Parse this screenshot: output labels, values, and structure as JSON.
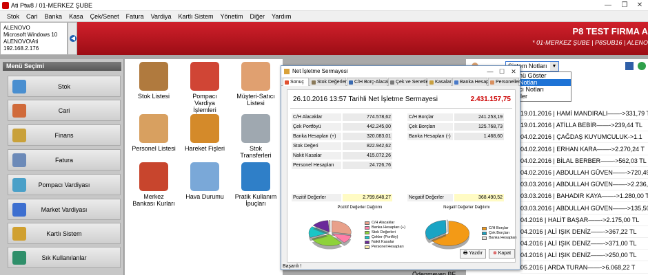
{
  "window": {
    "title": "Ati Ptw8  /  01-MERKEZ ŞUBE"
  },
  "menu": [
    "Stok",
    "Cari",
    "Banka",
    "Kasa",
    "Çek/Senet",
    "Fatura",
    "Vardiya",
    "Kartlı Sistem",
    "Yönetim",
    "Diğer",
    "Yardım"
  ],
  "info": [
    "ALENOVO",
    "Microsoft Windows 10",
    "ALENOVO\\Ati",
    "192.168.2.176"
  ],
  "banner": {
    "firm": "P8 TEST FIRMA A",
    "sub": "* 01-MERKEZ ŞUBE | P8SUB16 | ALENO"
  },
  "sidebar": {
    "header": "Menü Seçimi",
    "items": [
      {
        "label": "Stok",
        "color": "#4a8fd0"
      },
      {
        "label": "Cari",
        "color": "#d06a3a"
      },
      {
        "label": "Finans",
        "color": "#c9a13a"
      },
      {
        "label": "Fatura",
        "color": "#6c8ab8"
      },
      {
        "label": "Pompacı Vardiyası",
        "color": "#4aa0c8"
      },
      {
        "label": "Market Vardiyası",
        "color": "#3d6fd0"
      },
      {
        "label": "Kartlı Sistem",
        "color": "#d0a030"
      },
      {
        "label": "Sık Kullanılanlar",
        "color": "#2f8f6a"
      }
    ]
  },
  "tiles": [
    {
      "label": "Stok Listesi",
      "color": "#b07a3e"
    },
    {
      "label": "Pompacı Vardiya İşlemleri",
      "color": "#d04535"
    },
    {
      "label": "Müşteri-Satıcı Listesi",
      "color": "#e0a070"
    },
    {
      "label": "Personel Listesi",
      "color": "#d8a060"
    },
    {
      "label": "Hareket Fişleri",
      "color": "#d48a2a"
    },
    {
      "label": "Stok Transferleri",
      "color": "#9fa8b0"
    },
    {
      "label": "Merkez Bankası Kurları",
      "color": "#c8452d"
    },
    {
      "label": "Hava Durumu",
      "color": "#7aa8d8"
    },
    {
      "label": "Pratik Kullanım İpuçları",
      "color": "#2f7fc8"
    }
  ],
  "notes": {
    "selected": "Sistem Notları",
    "options": [
      "nü Göster",
      "Notları",
      "cı Notları",
      "ller"
    ],
    "label": "Notlar"
  },
  "log": [
    "19.01.2016 | HAMİ MANDIRALI——->331,79 T",
    "19.01.2016 | ATİLLA BEBİR——->239,44 TL",
    "04.02.2016 | ÇAĞDAŞ KUYUMCULUK->1.1",
    "04.02.2016 | ERHAN KARA——->2.270,24 T",
    "04.02.2016 | BİLAL    BERBER——->562,03 TL",
    "04.02.2016 | ABDULLAH GÜVEN——->720,49 T",
    "03.03.2016 | ABDULLAH GÜVEN——->2.236,50",
    "03.03.2016 | BAHADIR KAYA——->1.280,00 T",
    "03.03.2016 | ABDULLAH GÜVEN——->135,50 T",
    "04.2016 | HALİT BAŞAR——->2.175,00 TL",
    "04.2016 | ALİ IŞIK DENİZ——->367,22 TL",
    "04.2016 | ALİ IŞIK DENİZ——->371,00 TL",
    "04.2016 | ALİ IŞIK DENİZ——->250,00 TL",
    "05.2016 | ARDA TURAN——->6.068,22 T",
    "05.2016 | ABDULLAH GÜVEN——->225,85 T"
  ],
  "log_prefix": "Ödenmeyen BF",
  "dialog": {
    "title": "Net İşletme Sermayesi",
    "tabs": [
      "Sonuç",
      "Stok Değerleri",
      "C/H Borç-Alacak",
      "Çek ve Senetler",
      "Kasalar",
      "Banka Hesapları",
      "Personeller"
    ],
    "headline": "26.10.2016 13:57 Tarihli Net İşletme Sermayesi",
    "total": "2.431.157,75",
    "positive_rows": [
      {
        "k": "C/H Alacaklar",
        "v": "774.578,62"
      },
      {
        "k": "Çek Portföyü",
        "v": "442.245,00"
      },
      {
        "k": "Banka Hesapları (+)",
        "v": "320.083,01"
      },
      {
        "k": "Stok Değeri",
        "v": "822.942,62"
      },
      {
        "k": "Nakit Kasalar",
        "v": "415.072,26"
      },
      {
        "k": "Personel Hesapları",
        "v": "24.726,76"
      }
    ],
    "negative_rows": [
      {
        "k": "C/H Borçlar",
        "v": "241.253,19"
      },
      {
        "k": "Çek Borçları",
        "v": "125.768,73"
      },
      {
        "k": "Banka Hesapları (-)",
        "v": "1.468,60"
      }
    ],
    "positive_total": {
      "k": "Pozitif Değerler",
      "v": "2.799.648,27"
    },
    "negative_total": {
      "k": "Negatif Değerler",
      "v": "368.490,52"
    },
    "print": "Yazdır",
    "close": "Kapat",
    "status": "Başarılı !"
  },
  "chart_data": [
    {
      "type": "pie",
      "title": "Pozitif Değerler Dağılımı",
      "categories": [
        "C/H Alacaklar",
        "Banka Hesapları (+)",
        "Stok Değerleri",
        "Çekler (Portföy)",
        "Nakit Kasalar",
        "Personel Hesapları"
      ],
      "values": [
        774578.62,
        320083.01,
        822942.62,
        442245.0,
        415072.26,
        24726.76
      ],
      "colors": [
        "#e8a08a",
        "#ff7ea8",
        "#8ed23a",
        "#19c6c6",
        "#6b2a9a",
        "#f6e9a6"
      ],
      "legend": "right"
    },
    {
      "type": "pie",
      "title": "Negatif Değerler Dağılımı",
      "categories": [
        "C/H Borçlar",
        "Çek Borçları",
        "Banka Hesapları"
      ],
      "values": [
        241253.19,
        125768.73,
        1468.6
      ],
      "colors": [
        "#f39a16",
        "#1aa4c4",
        "#e8e0d8"
      ],
      "legend": "right"
    }
  ]
}
